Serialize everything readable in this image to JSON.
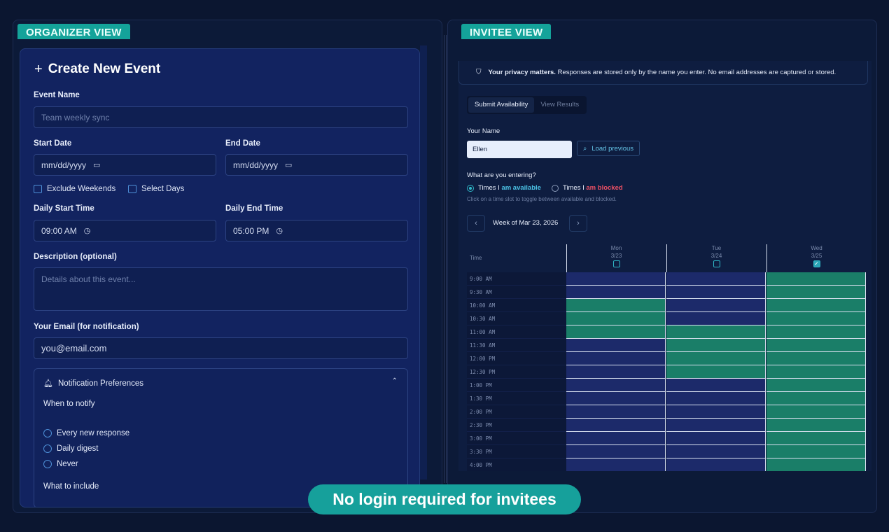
{
  "organizer": {
    "tag": "ORGANIZER VIEW",
    "title": "Create New Event",
    "event_name": {
      "label": "Event Name",
      "placeholder": "Team weekly sync"
    },
    "start_date": {
      "label": "Start Date",
      "value": "mm/dd/yyyy"
    },
    "end_date": {
      "label": "End Date",
      "value": "mm/dd/yyyy"
    },
    "exclude_weekends": "Exclude Weekends",
    "select_days": "Select Days",
    "daily_start": {
      "label": "Daily Start Time",
      "value": "09:00 AM"
    },
    "daily_end": {
      "label": "Daily End Time",
      "value": "05:00 PM"
    },
    "description": {
      "label": "Description (optional)",
      "placeholder": "Details about this event..."
    },
    "email": {
      "label": "Your Email (for notification)",
      "value": "you@email.com"
    },
    "notifications": {
      "title": "Notification Preferences",
      "when_label": "When to notify",
      "options": [
        "Every new response",
        "Daily digest",
        "Never"
      ],
      "include_label": "What to include"
    }
  },
  "invitee": {
    "tag": "INVITEE VIEW",
    "privacy_bold": "Your privacy matters.",
    "privacy_text": "Responses are stored only by the name you enter. No email addresses are captured or stored.",
    "tabs": [
      "Submit Availability",
      "View Results"
    ],
    "name_label": "Your Name",
    "name_value": "Ellen",
    "load_button": "Load previous",
    "entering_label": "What are you entering?",
    "option_available_prefix": "Times I",
    "option_available_hl": "am available",
    "option_blocked_prefix": "Times I",
    "option_blocked_hl": "am blocked",
    "hint": "Click on a time slot to toggle between available and blocked.",
    "prev_icon": "‹",
    "next_icon": "›",
    "week_label": "Week of Mar 23, 2026",
    "time_header": "Time",
    "days": [
      {
        "name": "Mon",
        "date": "3/23",
        "checked": false
      },
      {
        "name": "Tue",
        "date": "3/24",
        "checked": false
      },
      {
        "name": "Wed",
        "date": "3/25",
        "checked": true
      }
    ],
    "times": [
      "9:00 AM",
      "9:30 AM",
      "10:00 AM",
      "10:30 AM",
      "11:00 AM",
      "11:30 AM",
      "12:00 PM",
      "12:30 PM",
      "1:00 PM",
      "1:30 PM",
      "2:00 PM",
      "2:30 PM",
      "3:00 PM",
      "3:30 PM",
      "4:00 PM"
    ],
    "availability": [
      [
        0,
        0,
        1
      ],
      [
        0,
        0,
        1
      ],
      [
        1,
        0,
        1
      ],
      [
        1,
        0,
        1
      ],
      [
        1,
        1,
        1
      ],
      [
        0,
        1,
        1
      ],
      [
        0,
        1,
        1
      ],
      [
        0,
        1,
        1
      ],
      [
        0,
        0,
        1
      ],
      [
        0,
        0,
        1
      ],
      [
        0,
        0,
        1
      ],
      [
        0,
        0,
        1
      ],
      [
        0,
        0,
        1
      ],
      [
        0,
        0,
        1
      ],
      [
        0,
        0,
        1
      ]
    ]
  },
  "banner": "No login required for invitees",
  "colors": {
    "accent": "#14a39a",
    "available": "#1a7e68",
    "unavailable": "#1c2a6a",
    "blocked_text": "#ec5064",
    "available_text": "#4cc3e6"
  }
}
